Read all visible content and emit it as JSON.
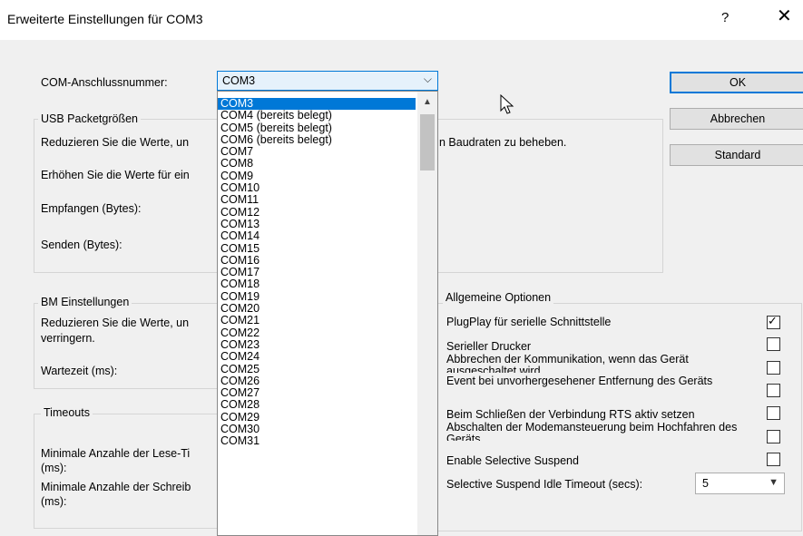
{
  "window": {
    "title": "Erweiterte Einstellungen für COM3",
    "help": "?",
    "close": "✕"
  },
  "com": {
    "label": "COM-Anschlussnummer:",
    "selected": "COM3",
    "options": [
      "COM3",
      "COM4 (bereits belegt)",
      "COM5 (bereits belegt)",
      "COM6 (bereits belegt)",
      "COM7",
      "COM8",
      "COM9",
      "COM10",
      "COM11",
      "COM12",
      "COM13",
      "COM14",
      "COM15",
      "COM16",
      "COM17",
      "COM18",
      "COM19",
      "COM20",
      "COM21",
      "COM22",
      "COM23",
      "COM24",
      "COM25",
      "COM26",
      "COM27",
      "COM28",
      "COM29",
      "COM30",
      "COM31"
    ]
  },
  "buttons": {
    "ok": "OK",
    "cancel": "Abbrechen",
    "default": "Standard"
  },
  "usb": {
    "legend": "USB Packetgrößen",
    "reduce_text_left": "Reduzieren Sie die Werte, un",
    "reduce_text_right": "n Baudraten zu beheben.",
    "increase_text": "Erhöhen Sie die Werte für ein",
    "receive": "Empfangen (Bytes):",
    "send": "Senden (Bytes):"
  },
  "bm": {
    "legend": "BM Einstellungen",
    "reduce_line1": "Reduzieren Sie die Werte, un",
    "reduce_line2": "verringern.",
    "latency": "Wartezeit (ms):"
  },
  "timeouts": {
    "legend": "Timeouts",
    "read_line1": "Minimale Anzahle der Lese-Ti",
    "read_line2": "(ms):",
    "write_line1": "Minimale Anzahle der Schreib",
    "write_line2": "(ms):"
  },
  "general": {
    "legend": "Allgemeine Optionen",
    "options": [
      {
        "label": "PlugPlay für serielle Schnittstelle",
        "checked": true
      },
      {
        "label": "Serieller Drucker",
        "checked": false
      },
      {
        "label": "Abbrechen der Kommunikation, wenn das Gerät ausgeschaltet wird",
        "checked": false
      },
      {
        "label": "Event bei unvorhergesehener Entfernung des Geräts",
        "checked": false
      },
      {
        "label": "Beim Schließen der Verbindung RTS aktiv setzen",
        "checked": false
      },
      {
        "label": "Abschalten der Modemansteuerung beim Hochfahren des Geräts",
        "checked": false
      },
      {
        "label": "Enable Selective Suspend",
        "checked": false
      }
    ],
    "idle_timeout_label": "Selective Suspend Idle Timeout (secs):",
    "idle_timeout_value": "5",
    "check_mark": "✓"
  }
}
